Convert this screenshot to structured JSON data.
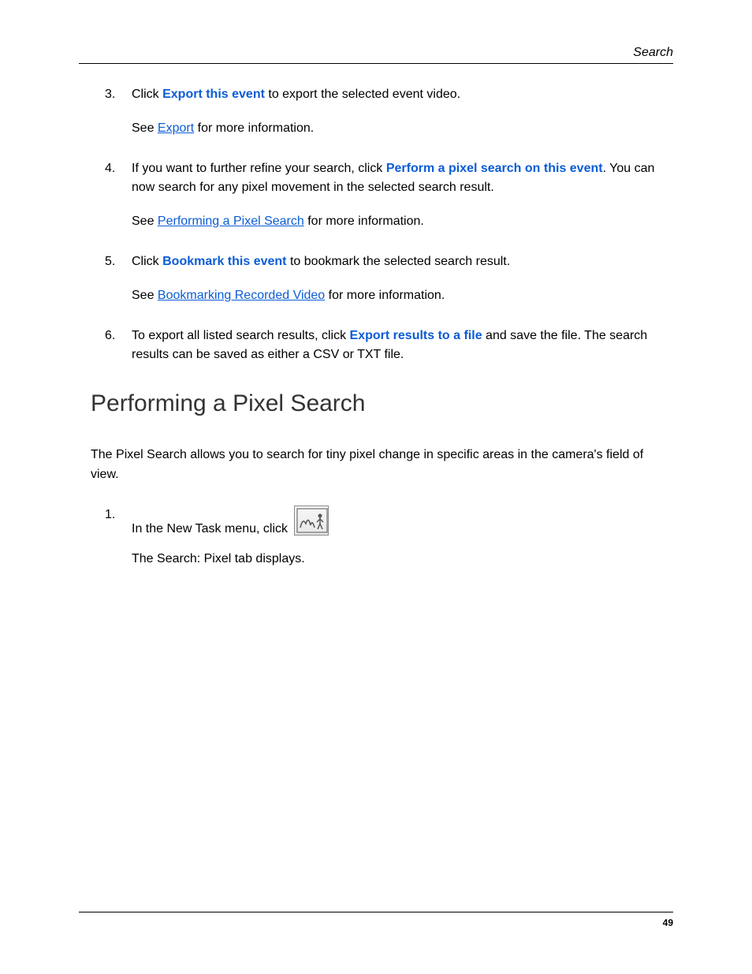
{
  "header": {
    "section": "Search"
  },
  "steps": [
    {
      "num": "3.",
      "pre": "Click ",
      "bold": "Export this event",
      "post": " to export the selected event video.",
      "see_pre": "See ",
      "see_link": "Export",
      "see_post": " for more information."
    },
    {
      "num": "4.",
      "pre": "If you want to further refine your search, click ",
      "bold": "Perform a pixel search on this event",
      "post": ". You can now search for any pixel movement in the selected search result.",
      "see_pre": "See ",
      "see_link": "Performing a Pixel Search",
      "see_post": " for more information."
    },
    {
      "num": "5.",
      "pre": "Click ",
      "bold": "Bookmark this event",
      "post": " to bookmark the selected search result.",
      "see_pre": "See ",
      "see_link": "Bookmarking Recorded Video",
      "see_post": " for more information."
    },
    {
      "num": "6.",
      "pre": "To export all listed search results, click ",
      "bold": "Export results to a file",
      "post": " and save the file. The search results can be saved as either a CSV or TXT file."
    }
  ],
  "heading": "Performing a Pixel Search",
  "intro": "The Pixel Search allows you to search for tiny pixel change in specific areas in the camera's field of view.",
  "step1": {
    "num": "1.",
    "text": "In the New Task menu, click",
    "follow": "The Search: Pixel tab displays."
  },
  "page_number": "49"
}
